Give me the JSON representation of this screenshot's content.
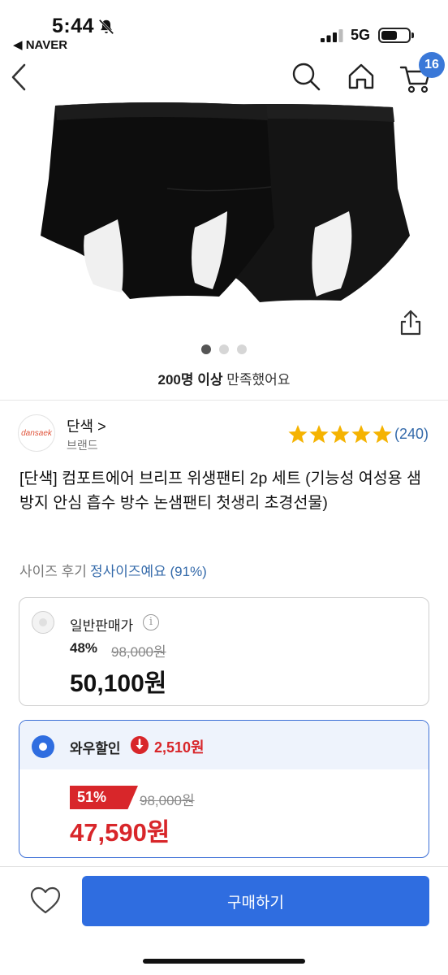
{
  "status_bar": {
    "time": "5:44",
    "back_app": "◀ NAVER",
    "network": "5G"
  },
  "nav": {
    "cart_count": "16",
    "icons": [
      "back-arrow-icon",
      "search-icon",
      "home-icon",
      "cart-icon"
    ]
  },
  "gallery": {
    "image_count": 3,
    "active_index": 0,
    "satisfied_bold": "200명 이상",
    "satisfied_text": " 만족했어요"
  },
  "brand": {
    "logo_text": "dansaek",
    "name": "단색 >",
    "sub": "브랜드"
  },
  "rating": {
    "stars": 5,
    "count": "(240)",
    "color": "#f5b301"
  },
  "product": {
    "title": "[단색] 컴포트에어 브리프 위생팬티 2p 세트 (기능성 여성용 샘방지 안심 흡수 방수 논샘팬티 첫생리 초경선물)"
  },
  "size_review": {
    "label": "사이즈 후기",
    "value": "정사이즈예요 (91%)"
  },
  "options": {
    "normal": {
      "label": "일반판매가",
      "discount_rate": "48%",
      "original_price": "98,000원",
      "price": "50,100원",
      "selected": false
    },
    "wow": {
      "label": "와우할인",
      "extra_discount": "2,510원",
      "discount_rate": "51%",
      "original_price": "98,000원",
      "price": "47,590원",
      "selected": true
    }
  },
  "bottom": {
    "buy_label": "구매하기"
  },
  "colors": {
    "accent_blue": "#2f6de0",
    "sale_red": "#d8262a",
    "link_blue": "#346aaa"
  }
}
